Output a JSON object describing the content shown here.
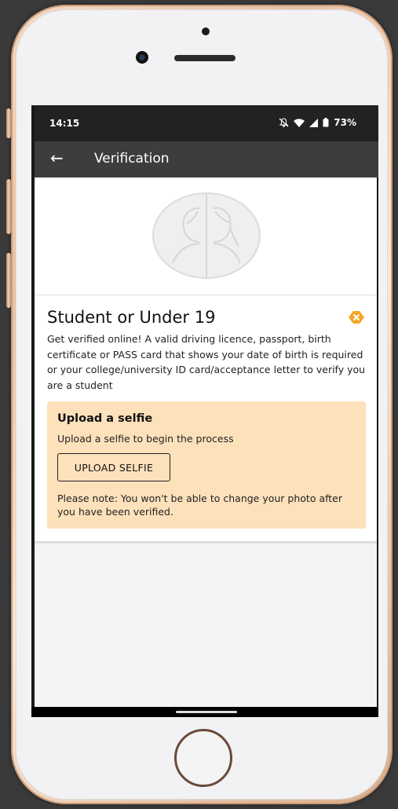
{
  "status_bar": {
    "time": "14:15",
    "battery": "73%"
  },
  "app_bar": {
    "title": "Verification",
    "back_icon": "arrow-left-icon"
  },
  "card": {
    "title": "Student or Under 19",
    "status_icon": "warning-icon",
    "status_color": "#f5a623",
    "description": "Get verified online! A valid driving licence, passport, birth certificate or PASS card that shows your date of birth is required or your college/university ID card/acceptance letter to verify you are a student",
    "notice": {
      "title": "Upload a selfie",
      "subtitle": "Upload a selfie to begin the process",
      "button_label": "UPLOAD SELFIE",
      "note": "Please note: You won't be able to change your photo after you have been verified.",
      "background": "#fde1bb"
    }
  }
}
